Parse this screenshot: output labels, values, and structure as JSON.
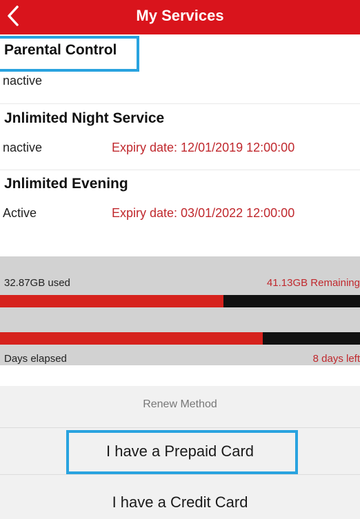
{
  "header": {
    "title": "My Services",
    "back_icon": "chevron-left-icon"
  },
  "services": [
    {
      "name": "Parental Control",
      "status": "nactive",
      "expiry": ""
    },
    {
      "name": "Jnlimited Night Service",
      "status": "nactive",
      "expiry": "Expiry date: 12/01/2019 12:00:00"
    },
    {
      "name": "Jnlimited Evening",
      "status": "Active",
      "expiry": "Expiry date: 03/01/2022 12:00:00"
    }
  ],
  "usage": {
    "used_label": "32.87GB used",
    "remaining_label": "41.13GB Remaining",
    "data_used_fraction": 0.62,
    "days_elapsed_label": "Days elapsed",
    "days_left_label": "8 days left",
    "days_elapsed_fraction": 0.73,
    "colors": {
      "fill": "#d6221d",
      "track": "#111111"
    }
  },
  "renew": {
    "title": "Renew Method",
    "options": [
      "I have a Prepaid Card",
      "I have a Credit Card"
    ]
  },
  "colors": {
    "brand": "#d9141c",
    "highlight": "#29a3df",
    "expiry": "#c0282d"
  }
}
